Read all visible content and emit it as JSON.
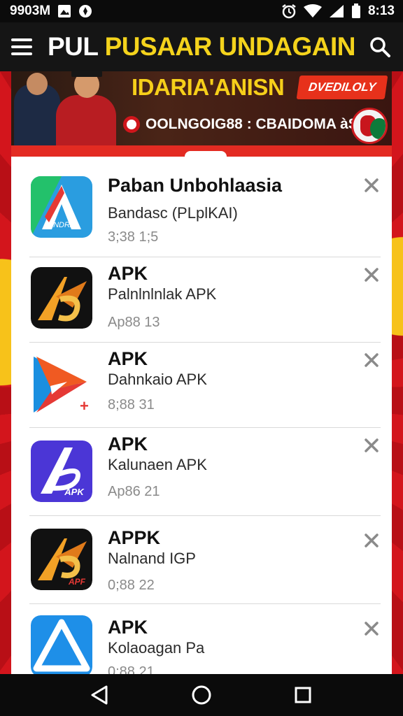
{
  "status_bar": {
    "left_text": "9903M",
    "time": "8:13",
    "icons": [
      "gallery-icon",
      "notification-icon",
      "alarm-icon",
      "wifi-icon",
      "signal-icon",
      "battery-icon"
    ]
  },
  "app_bar": {
    "title_part1": "PUL",
    "title_part2": "PUSAAR UNDAGAIN",
    "menu_icon": "menu-icon",
    "search_icon": "search-icon"
  },
  "banner": {
    "headline": "IDARIA'ANISN",
    "badge": "DVEDILOLY",
    "ticker": "OOLNGOIG88 : CBAIDOMA àS"
  },
  "list": {
    "items": [
      {
        "title": "Paban Unbohlaasia",
        "subtitle": "Bandasc (PLplKAI)",
        "meta": "3;38 1;5",
        "icon": "blue-green-a-icon"
      },
      {
        "title": "APK",
        "subtitle": "Palnlnlnlak APK",
        "meta": "Ap88 13",
        "icon": "orange-a-black-icon"
      },
      {
        "title": "APK",
        "subtitle": "Dahnkaio APK",
        "meta": "8;88 31",
        "icon": "red-play-icon"
      },
      {
        "title": "APK",
        "subtitle": "Kalunaen APK",
        "meta": "Ap86 21",
        "icon": "purple-apk-icon"
      },
      {
        "title": "APPK",
        "subtitle": "Nalnand IGP",
        "meta": "0;88 22",
        "icon": "orange-a-apf-icon"
      },
      {
        "title": "APK",
        "subtitle": "Kolaoagan Pa",
        "meta": "0;88 21",
        "icon": "blue-triangle-icon"
      }
    ]
  },
  "nav_bar": {
    "icons": [
      "back-icon",
      "home-icon",
      "recents-icon"
    ]
  },
  "colors": {
    "title_yellow": "#f4d31c",
    "accent_red": "#c8161d",
    "bar_dark": "#0b0b0b"
  }
}
